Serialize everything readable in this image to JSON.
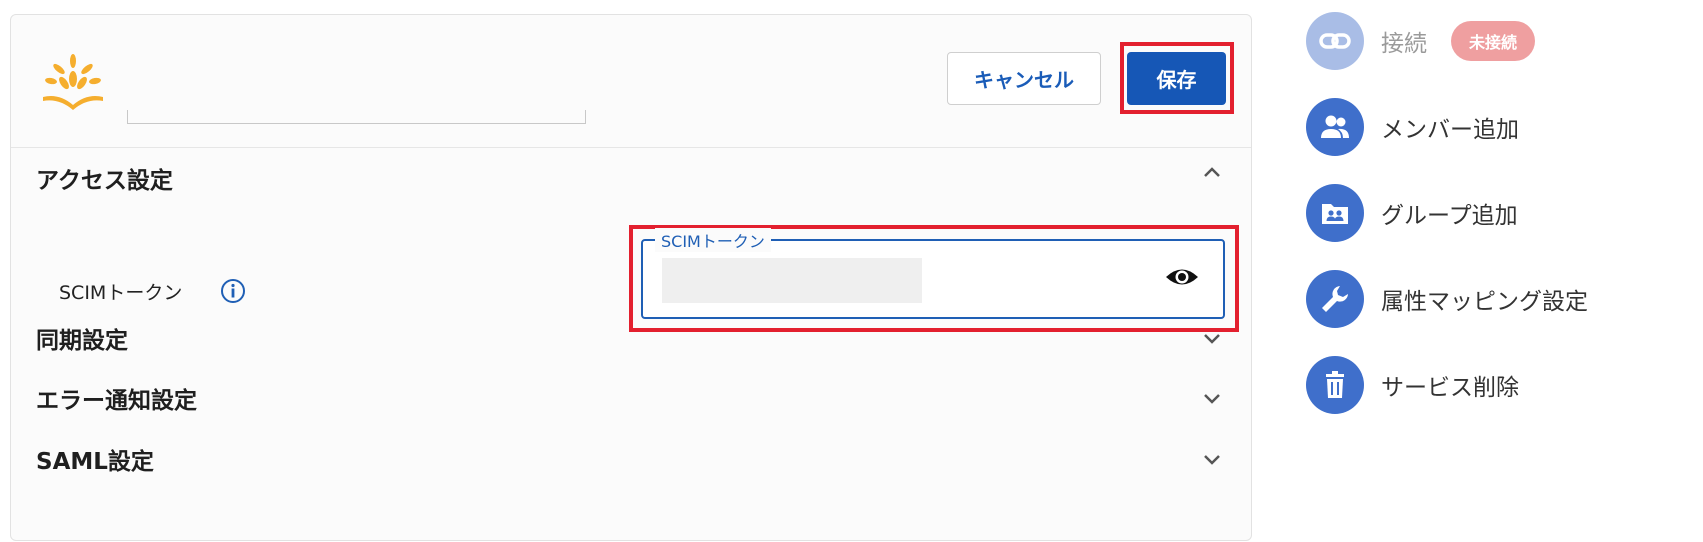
{
  "header": {
    "cancel_label": "キャンセル",
    "save_label": "保存",
    "logo_icon": "sprout-book-icon"
  },
  "sections": [
    {
      "title": "アクセス設定",
      "expanded": true
    },
    {
      "title": "同期設定",
      "expanded": false
    },
    {
      "title": "エラー通知設定",
      "expanded": false
    },
    {
      "title": "SAML設定",
      "expanded": false
    }
  ],
  "access": {
    "scim_label": "SCIMトークン",
    "field_legend": "SCIMトークン",
    "field_value": ""
  },
  "sidebar": {
    "items": [
      {
        "label": "接続",
        "icon": "link-icon",
        "disabled": true,
        "badge": "未接続"
      },
      {
        "label": "メンバー追加",
        "icon": "people-icon",
        "disabled": false
      },
      {
        "label": "グループ追加",
        "icon": "group-folder-icon",
        "disabled": false
      },
      {
        "label": "属性マッピング設定",
        "icon": "wrench-icon",
        "disabled": false
      },
      {
        "label": "サービス削除",
        "icon": "trash-icon",
        "disabled": false
      }
    ]
  },
  "colors": {
    "primary": "#1657b6",
    "highlight": "#e3202f",
    "badge": "#ef9fa0",
    "logo": "#f5ae2e"
  }
}
